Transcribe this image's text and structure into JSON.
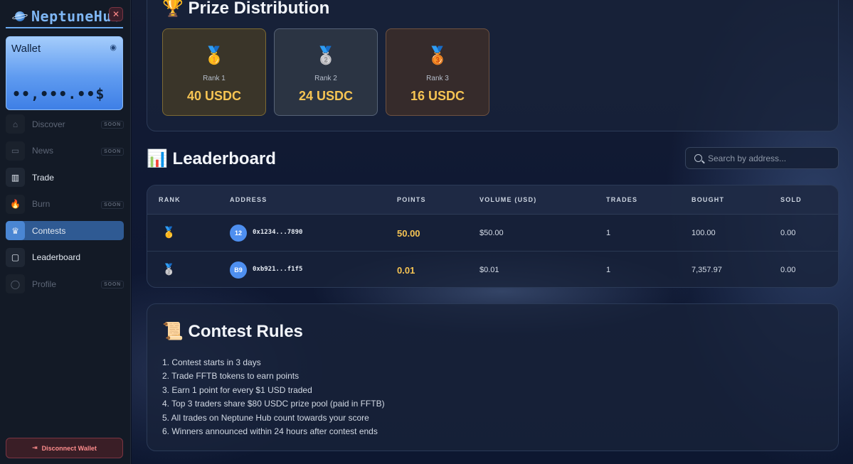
{
  "brand": {
    "name": "NeptuneHub",
    "close_glyph": "✕"
  },
  "wallet": {
    "title": "Wallet",
    "balance": "••,•••.••$"
  },
  "nav": {
    "items": [
      {
        "label": "Discover",
        "badge": "SOON",
        "icon": "home-icon",
        "glyph": "⌂"
      },
      {
        "label": "News",
        "badge": "SOON",
        "icon": "book-icon",
        "glyph": "▭"
      },
      {
        "label": "Trade",
        "badge": "",
        "icon": "bar-chart-icon",
        "glyph": "▥"
      },
      {
        "label": "Burn",
        "badge": "SOON",
        "icon": "flame-icon",
        "glyph": "🔥"
      },
      {
        "label": "Contests",
        "badge": "",
        "icon": "trophy-icon",
        "glyph": "♛"
      },
      {
        "label": "Leaderboard",
        "badge": "",
        "icon": "clipboard-icon",
        "glyph": "▢"
      },
      {
        "label": "Profile",
        "badge": "SOON",
        "icon": "user-icon",
        "glyph": "◯"
      }
    ],
    "active": "Contests"
  },
  "disconnect": {
    "label": "Disconnect Wallet",
    "glyph": "⇥"
  },
  "prize": {
    "title": "🏆 Prize Distribution",
    "cards": [
      {
        "medal": "🥇",
        "rank": "Rank 1",
        "amount": "40 USDC"
      },
      {
        "medal": "🥈",
        "rank": "Rank 2",
        "amount": "24 USDC"
      },
      {
        "medal": "🥉",
        "rank": "Rank 3",
        "amount": "16 USDC"
      }
    ]
  },
  "leaderboard": {
    "title": "📊 Leaderboard",
    "search_placeholder": "Search by address...",
    "columns": [
      "RANK",
      "ADDRESS",
      "POINTS",
      "VOLUME (USD)",
      "TRADES",
      "BOUGHT",
      "SOLD"
    ],
    "rows": [
      {
        "medal": "🥇",
        "avatar": "12",
        "address": "0x1234...7890",
        "points": "50.00",
        "volume": "$50.00",
        "trades": "1",
        "bought": "100.00",
        "sold": "0.00"
      },
      {
        "medal": "🥈",
        "avatar": "B9",
        "address": "0xb921...f1f5",
        "points": "0.01",
        "volume": "$0.01",
        "trades": "1",
        "bought": "7,357.97",
        "sold": "0.00"
      }
    ]
  },
  "rules": {
    "title": "📜 Contest Rules",
    "items": [
      "1. Contest starts in 3 days",
      "2. Trade FFTB tokens to earn points",
      "3. Earn 1 point for every $1 USD traded",
      "4. Top 3 traders share $80 USDC prize pool (paid in FFTB)",
      "5. All trades on Neptune Hub count towards your score",
      "6. Winners announced within 24 hours after contest ends"
    ]
  },
  "colors": {
    "accent": "#4a86d3",
    "gold": "#f6c453",
    "danger": "#ff8d8d"
  }
}
